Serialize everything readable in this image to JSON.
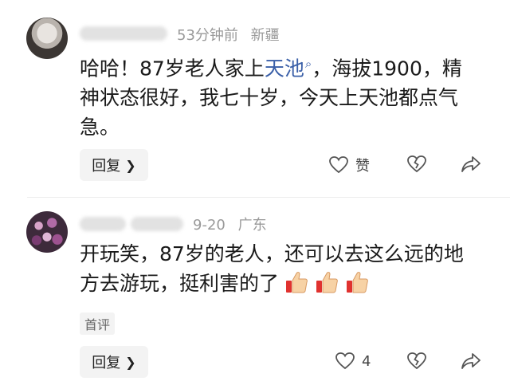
{
  "comments": [
    {
      "time": "53分钟前",
      "location": "新疆",
      "text_before": "哈哈！87岁老人家上",
      "link_text": "天池",
      "text_after": "，海拔1900，精神状态很好，我七十岁，今天上天池都点气急。",
      "reply_label": "回复",
      "like_label": "赞",
      "icons": [
        "heart-outline-icon",
        "broken-heart-icon",
        "share-arrow-icon"
      ]
    },
    {
      "time": "9-20",
      "location": "广东",
      "text": "开玩笑，87岁的老人，还可以去这么远的地方去游玩，挺利害的了",
      "emoji_count": 3,
      "tag": "首评",
      "reply_label": "回复",
      "like_count": "4",
      "icons": [
        "heart-outline-icon",
        "broken-heart-icon",
        "share-arrow-icon"
      ]
    }
  ],
  "colors": {
    "link": "#3a5fa8",
    "meta": "#9a9a9a",
    "button_bg": "#f3f3f3"
  }
}
